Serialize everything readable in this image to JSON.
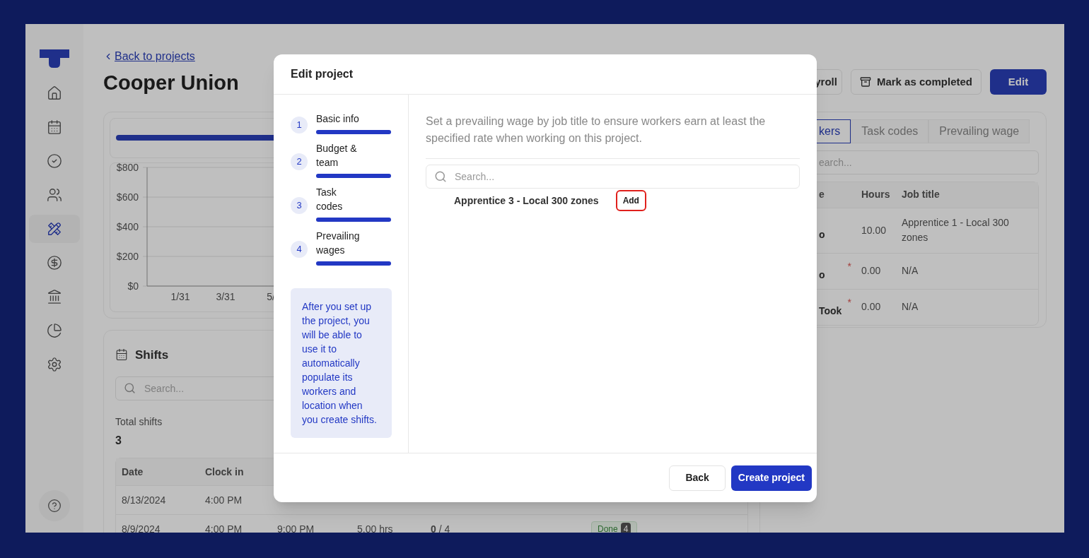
{
  "sidebar": {
    "items": [
      {
        "selected": false
      },
      {
        "selected": false
      },
      {
        "selected": false
      },
      {
        "selected": false
      },
      {
        "selected": true
      },
      {
        "selected": false
      },
      {
        "selected": false
      },
      {
        "selected": false
      },
      {
        "selected": false
      }
    ]
  },
  "header": {
    "back_link": "Back to projects",
    "title": "Cooper Union",
    "buttons": [
      {
        "label": "yroll",
        "kind": "plain"
      },
      {
        "label": "Mark as completed",
        "kind": "archive"
      },
      {
        "label": "Edit",
        "kind": "primary"
      }
    ]
  },
  "chart": {
    "chart_data": {
      "type": "line",
      "grid": true,
      "ylim": [
        0,
        800
      ],
      "categories": [
        "1/31",
        "3/31",
        "5/"
      ],
      "yticks": [
        {
          "value": 800,
          "label": "$800"
        },
        {
          "value": 600,
          "label": "$600"
        },
        {
          "value": 400,
          "label": "$400"
        },
        {
          "value": 200,
          "label": "$200"
        },
        {
          "value": 0,
          "label": "$0"
        }
      ]
    }
  },
  "shifts": {
    "title": "Shifts",
    "search": {
      "placeholder": "Search..."
    },
    "total_label": "Total shifts",
    "total": "3",
    "columns": [
      "Date",
      "Clock in"
    ],
    "rows": [
      {
        "cells": [
          "8/13/2024",
          "4:00 PM"
        ]
      },
      {
        "cells": [
          "8/9/2024",
          "4:00 PM",
          "9:00 PM",
          "5.00 hrs",
          "**0** / 4"
        ],
        "status": "Done",
        "count": "4"
      }
    ]
  },
  "workers": {
    "tabs": [
      {
        "label": "kers",
        "selected": true
      },
      {
        "label": "Task codes",
        "selected": false
      },
      {
        "label": "Prevailing wage",
        "selected": false
      }
    ],
    "search": {
      "placeholder": "earch..."
    },
    "columns": [
      "e",
      "Hours",
      "Job title"
    ],
    "required_mark": "*",
    "rows": [
      {
        "name": "o",
        "required": false,
        "hours": "10.00",
        "job_title": "Apprentice 1 - Local 300 zones"
      },
      {
        "name": "o",
        "required": true,
        "hours": "0.00",
        "job_title": "N/A"
      },
      {
        "name": "Took",
        "required": true,
        "hours": "0.00",
        "job_title": "N/A"
      }
    ]
  },
  "modal": {
    "title": "Edit project",
    "steps": [
      {
        "number": "1",
        "label": "Basic info",
        "level": 1
      },
      {
        "number": "2",
        "label": "Budget & team",
        "level": 1
      },
      {
        "number": "3",
        "label": "Task codes",
        "level": 1
      },
      {
        "number": "4",
        "label": "Prevailing wages",
        "level": 1
      }
    ],
    "info": "After you set up the project, you will be able to use it to automatically populate its workers and location when you create shifts.",
    "description": "Set a prevailing wage by job title to ensure workers earn at least the specified rate when working on this project.",
    "search": {
      "placeholder": "Search..."
    },
    "items": [
      {
        "label": "Apprentice 3 - Local 300 zones",
        "button": "Add",
        "highlighted": true
      }
    ],
    "buttons": [
      {
        "label": "Back",
        "kind": "secondary"
      },
      {
        "label": "Create project",
        "kind": "primary"
      }
    ]
  }
}
